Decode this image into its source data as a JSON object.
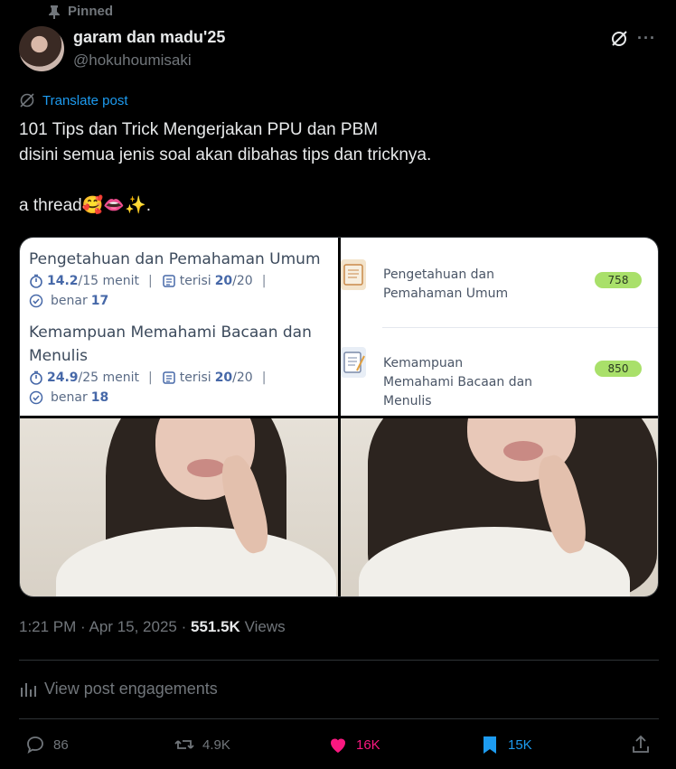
{
  "pinned_label": "Pinned",
  "author": {
    "name": "garam dan madu'25",
    "handle": "@hokuhoumisaki"
  },
  "translate_label": "Translate post",
  "post": {
    "text": "101 Tips dan Trick Mengerjakan PPU dan PBM\ndisini semua jenis soal akan dibahas tips dan tricknya.\n\na thread🥰👄✨."
  },
  "media": {
    "panel1": {
      "section1": {
        "title": "Pengetahuan dan Pemahaman Umum",
        "time_value": "14.2",
        "time_total": "/15 menit",
        "filled_label": "terisi",
        "filled_value": "20",
        "filled_total": "/20",
        "correct_label": "benar",
        "correct_value": "17"
      },
      "section2": {
        "title_line1": "Kemampuan Memahami Bacaan dan",
        "title_line2": "Menulis",
        "time_value": "24.9",
        "time_total": "/25 menit",
        "filled_label": "terisi",
        "filled_value": "20",
        "filled_total": "/20",
        "correct_label": "benar",
        "correct_value": "18"
      },
      "separator": "|"
    },
    "panel2": {
      "items": [
        {
          "label": "Pengetahuan dan Pemahaman Umum",
          "score": "758"
        },
        {
          "label": "Kemampuan Memahami Bacaan dan Menulis",
          "score": "850"
        }
      ]
    }
  },
  "meta": {
    "time": "1:21 PM",
    "dot": "·",
    "date": "Apr 15, 2025",
    "views_count": "551.5K",
    "views_label": "Views"
  },
  "engagements_label": "View post engagements",
  "actions": {
    "replies": "86",
    "reposts": "4.9K",
    "likes": "16K",
    "bookmarks": "15K"
  },
  "colors": {
    "accent": "#1d9bf0",
    "like": "#f91880",
    "muted": "#71767b",
    "text": "#e7e9ea",
    "score_pill": "#a9e06a"
  }
}
